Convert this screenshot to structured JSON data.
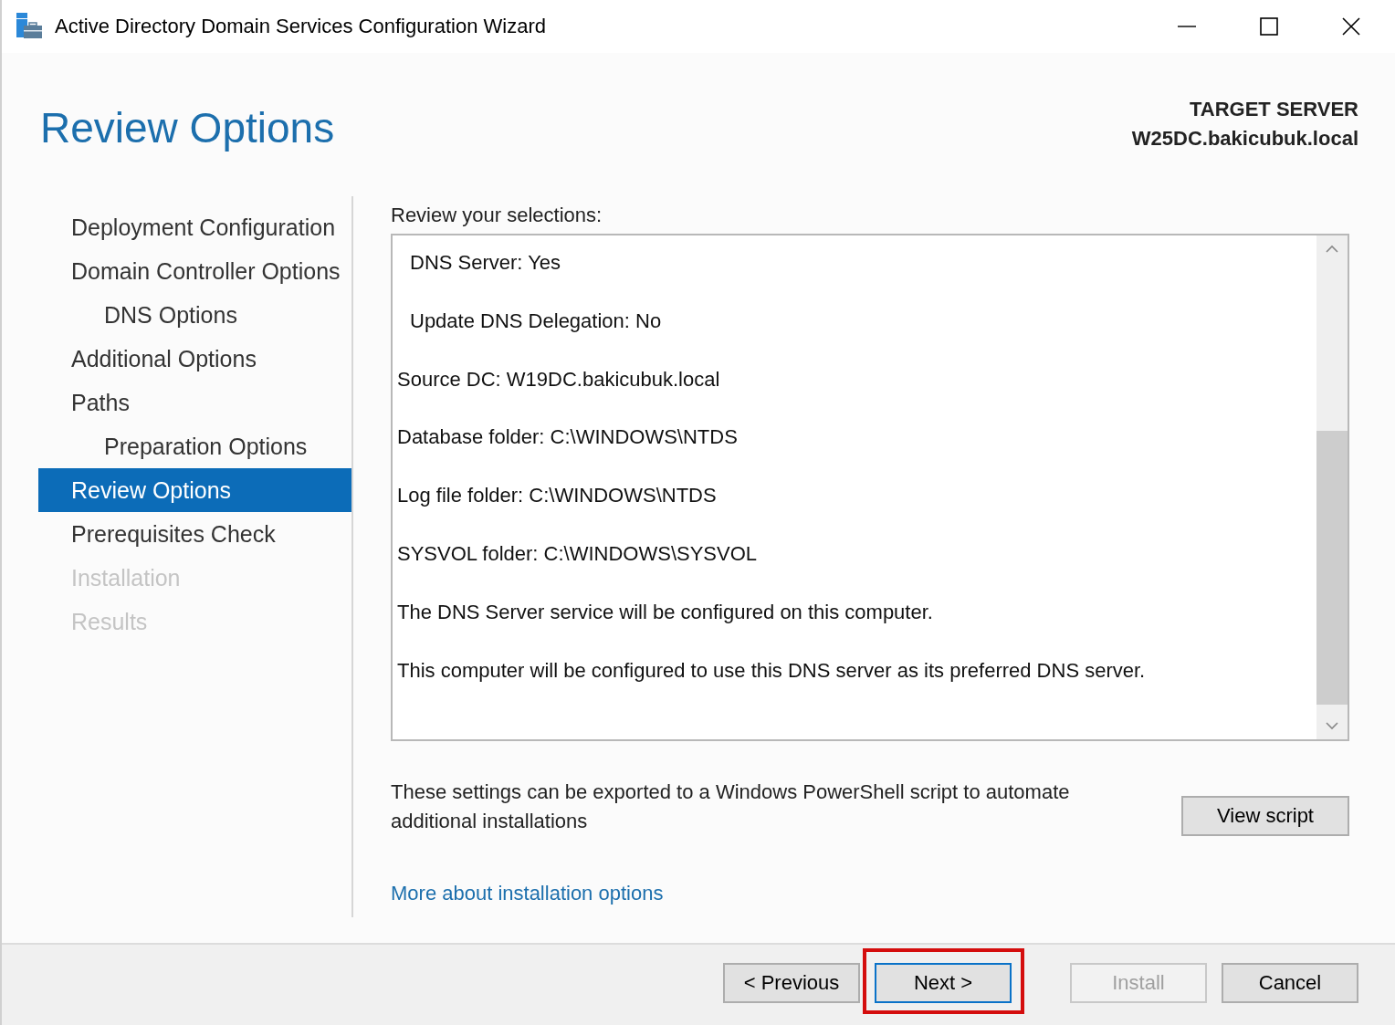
{
  "window": {
    "title": "Active Directory Domain Services Configuration Wizard"
  },
  "header": {
    "title": "Review Options",
    "target_label": "TARGET SERVER",
    "target_server": "W25DC.bakicubuk.local"
  },
  "sidebar": {
    "items": [
      {
        "label": "Deployment Configuration",
        "selected": false,
        "disabled": false
      },
      {
        "label": "Domain Controller Options",
        "selected": false,
        "disabled": false,
        "children": [
          {
            "label": "DNS Options",
            "selected": false,
            "disabled": false
          }
        ]
      },
      {
        "label": "Additional Options",
        "selected": false,
        "disabled": false
      },
      {
        "label": "Paths",
        "selected": false,
        "disabled": false,
        "children": [
          {
            "label": "Preparation Options",
            "selected": false,
            "disabled": false
          }
        ]
      },
      {
        "label": "Review Options",
        "selected": true,
        "disabled": false
      },
      {
        "label": "Prerequisites Check",
        "selected": false,
        "disabled": false
      },
      {
        "label": "Installation",
        "selected": false,
        "disabled": true
      },
      {
        "label": "Results",
        "selected": false,
        "disabled": true
      }
    ]
  },
  "review": {
    "heading": "Review your selections:",
    "lines": [
      {
        "text": "DNS Server: Yes",
        "indented": true
      },
      {
        "text": "Update DNS Delegation: No",
        "indented": true
      },
      {
        "text": "Source DC: W19DC.bakicubuk.local",
        "indented": false
      },
      {
        "text": "Database folder: C:\\WINDOWS\\NTDS",
        "indented": false
      },
      {
        "text": "Log file folder: C:\\WINDOWS\\NTDS",
        "indented": false
      },
      {
        "text": "SYSVOL folder: C:\\WINDOWS\\SYSVOL",
        "indented": false
      },
      {
        "text": "The DNS Server service will be configured on this computer.",
        "indented": false
      },
      {
        "text": "This computer will be configured to use this DNS server as its preferred DNS server.",
        "indented": false
      }
    ]
  },
  "export": {
    "text": "These settings can be exported to a Windows PowerShell script to automate additional installations",
    "button": "View script"
  },
  "link": "More about installation options",
  "buttons": [
    {
      "label": "< Previous",
      "disabled": false,
      "focused": false,
      "highlighted": false
    },
    {
      "label": "Next >",
      "disabled": false,
      "focused": true,
      "highlighted": true
    },
    {
      "label": "Install",
      "disabled": true,
      "focused": false,
      "highlighted": false
    },
    {
      "label": "Cancel",
      "disabled": false,
      "focused": false,
      "highlighted": false
    }
  ]
}
